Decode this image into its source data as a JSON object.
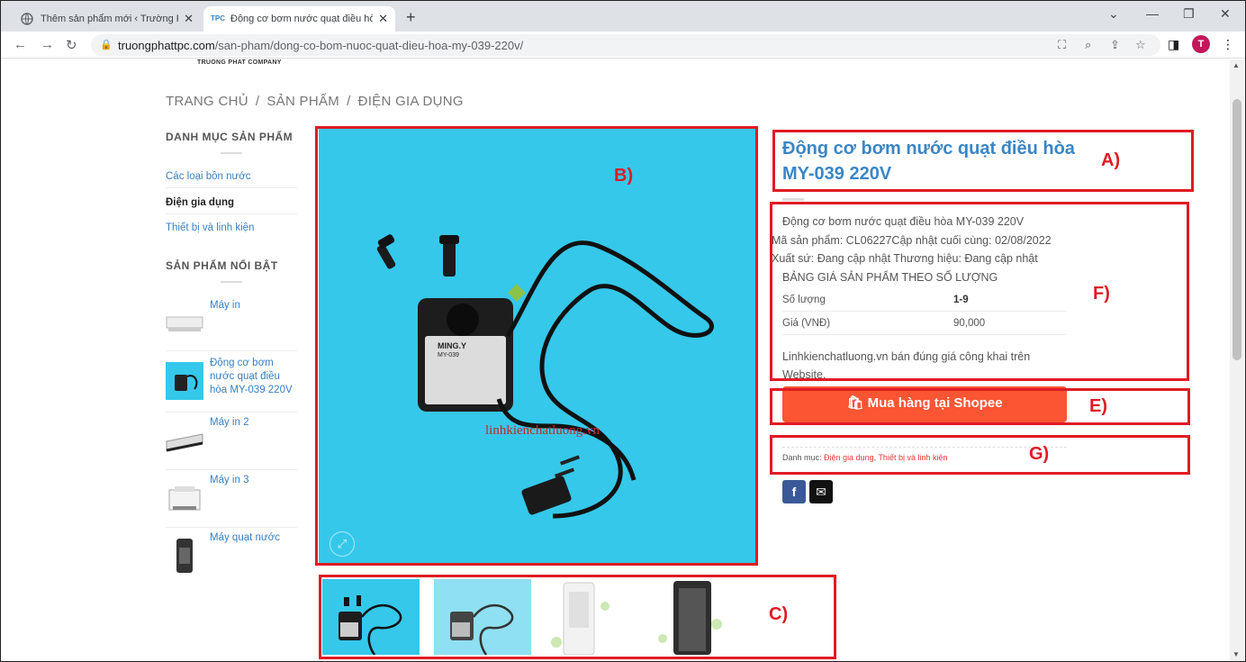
{
  "browser": {
    "tabs": [
      {
        "title": "Thêm sản phẩm mới ‹ Trường Phá"
      },
      {
        "title": "Động cơ bơm nước quạt điều hò"
      }
    ],
    "url_domain": "truongphattpc.com",
    "url_path": "/san-pham/dong-co-bom-nuoc-quat-dieu-hoa-my-039-220v/",
    "avatar_letter": "T"
  },
  "site": {
    "logo_text": "TRUONG PHAT COMPANY"
  },
  "breadcrumb": [
    "TRANG CHỦ",
    "/",
    "SẢN PHẨM",
    "/",
    "ĐIỆN GIA DỤNG"
  ],
  "sidebar": {
    "categories_heading": "DANH MỤC SẢN PHẨM",
    "categories": [
      {
        "label": "Các loại bồn nước",
        "active": false
      },
      {
        "label": "Điện gia dụng",
        "active": true
      },
      {
        "label": "Thiết bị và linh kiện",
        "active": false
      }
    ],
    "featured_heading": "SẢN PHẨM NỔI BẬT",
    "featured": [
      {
        "name": "Máy in"
      },
      {
        "name": "Động cơ bơm nước quạt điều hòa MY-039 220V"
      },
      {
        "name": "Máy in 2"
      },
      {
        "name": "Máy in 3"
      },
      {
        "name": "Máy quạt nước"
      }
    ]
  },
  "product": {
    "title": "Động cơ bơm nước quạt điều hòa MY-039 220V",
    "image_watermark": "linhkienchatluong.vn",
    "pump_label": "MING.Y",
    "pump_model": "MY-039",
    "desc_line1": "Động cơ bơm nước quạt điều hòa MY-039 220V",
    "desc_line2": "Mã sản phẩm: CL06227Cập nhật cuối cùng: 02/08/2022",
    "desc_line3": "Xuất sứ: Đang cập nhật Thương hiệu: Đang cập nhật",
    "price_table_title": "BẢNG GIÁ SẢN PHẨM THEO SỐ LƯỢNG",
    "price_table": [
      {
        "label": "Số lượng",
        "value": "1-9"
      },
      {
        "label": "Giá (VNĐ)",
        "value": "90,000"
      }
    ],
    "note_line1": "Linhkienchatluong.vn bán đúng giá công khai trên",
    "note_line2": "Website.",
    "buy_button": "Mua hàng tại Shopee",
    "categories_label": "Danh mục:",
    "category_links": [
      "Điện gia dụng",
      "Thiết bị và linh kiện"
    ],
    "share_facebook": "f",
    "share_email": "✉"
  },
  "annotations": {
    "A": "A)",
    "B": "B)",
    "C": "C)",
    "E": "E)",
    "F": "F)",
    "G": "G)"
  },
  "colors": {
    "accent_blue": "#3a86c6",
    "shopee_orange": "#fb5533",
    "annotation_red": "#e01b24",
    "image_bg": "#35c8ea"
  }
}
